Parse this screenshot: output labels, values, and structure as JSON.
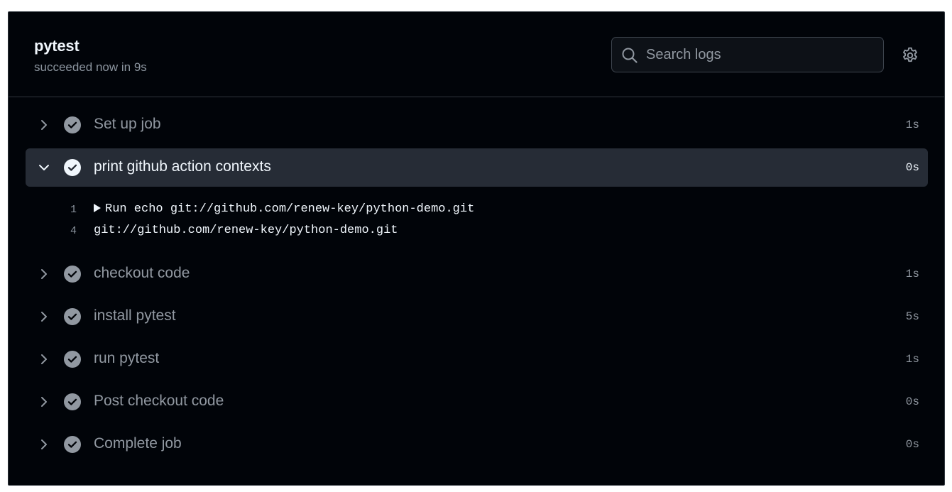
{
  "job": {
    "title": "pytest",
    "status": "succeeded now in 9s"
  },
  "search": {
    "placeholder": "Search logs"
  },
  "icons": {
    "search": "search-icon",
    "settings": "gear-icon",
    "collapsed": "chevron-right-icon",
    "expanded": "chevron-down-icon",
    "success": "check-circle-icon"
  },
  "colors": {
    "background": "#010409",
    "expanded_row": "#262c36",
    "text_primary": "#f0f6fc",
    "text_muted": "#9198a1",
    "success_icon": "#9198a1"
  },
  "steps": [
    {
      "name": "Set up job",
      "duration": "1s",
      "expanded": false
    },
    {
      "name": "print github action contexts",
      "duration": "0s",
      "expanded": true,
      "log": [
        {
          "line": "1",
          "text": "Run echo git://github.com/renew-key/python-demo.git",
          "group": true
        },
        {
          "line": "4",
          "text": "git://github.com/renew-key/python-demo.git",
          "group": false
        }
      ]
    },
    {
      "name": "checkout code",
      "duration": "1s",
      "expanded": false
    },
    {
      "name": "install pytest",
      "duration": "5s",
      "expanded": false
    },
    {
      "name": "run pytest",
      "duration": "1s",
      "expanded": false
    },
    {
      "name": "Post checkout code",
      "duration": "0s",
      "expanded": false
    },
    {
      "name": "Complete job",
      "duration": "0s",
      "expanded": false
    }
  ]
}
